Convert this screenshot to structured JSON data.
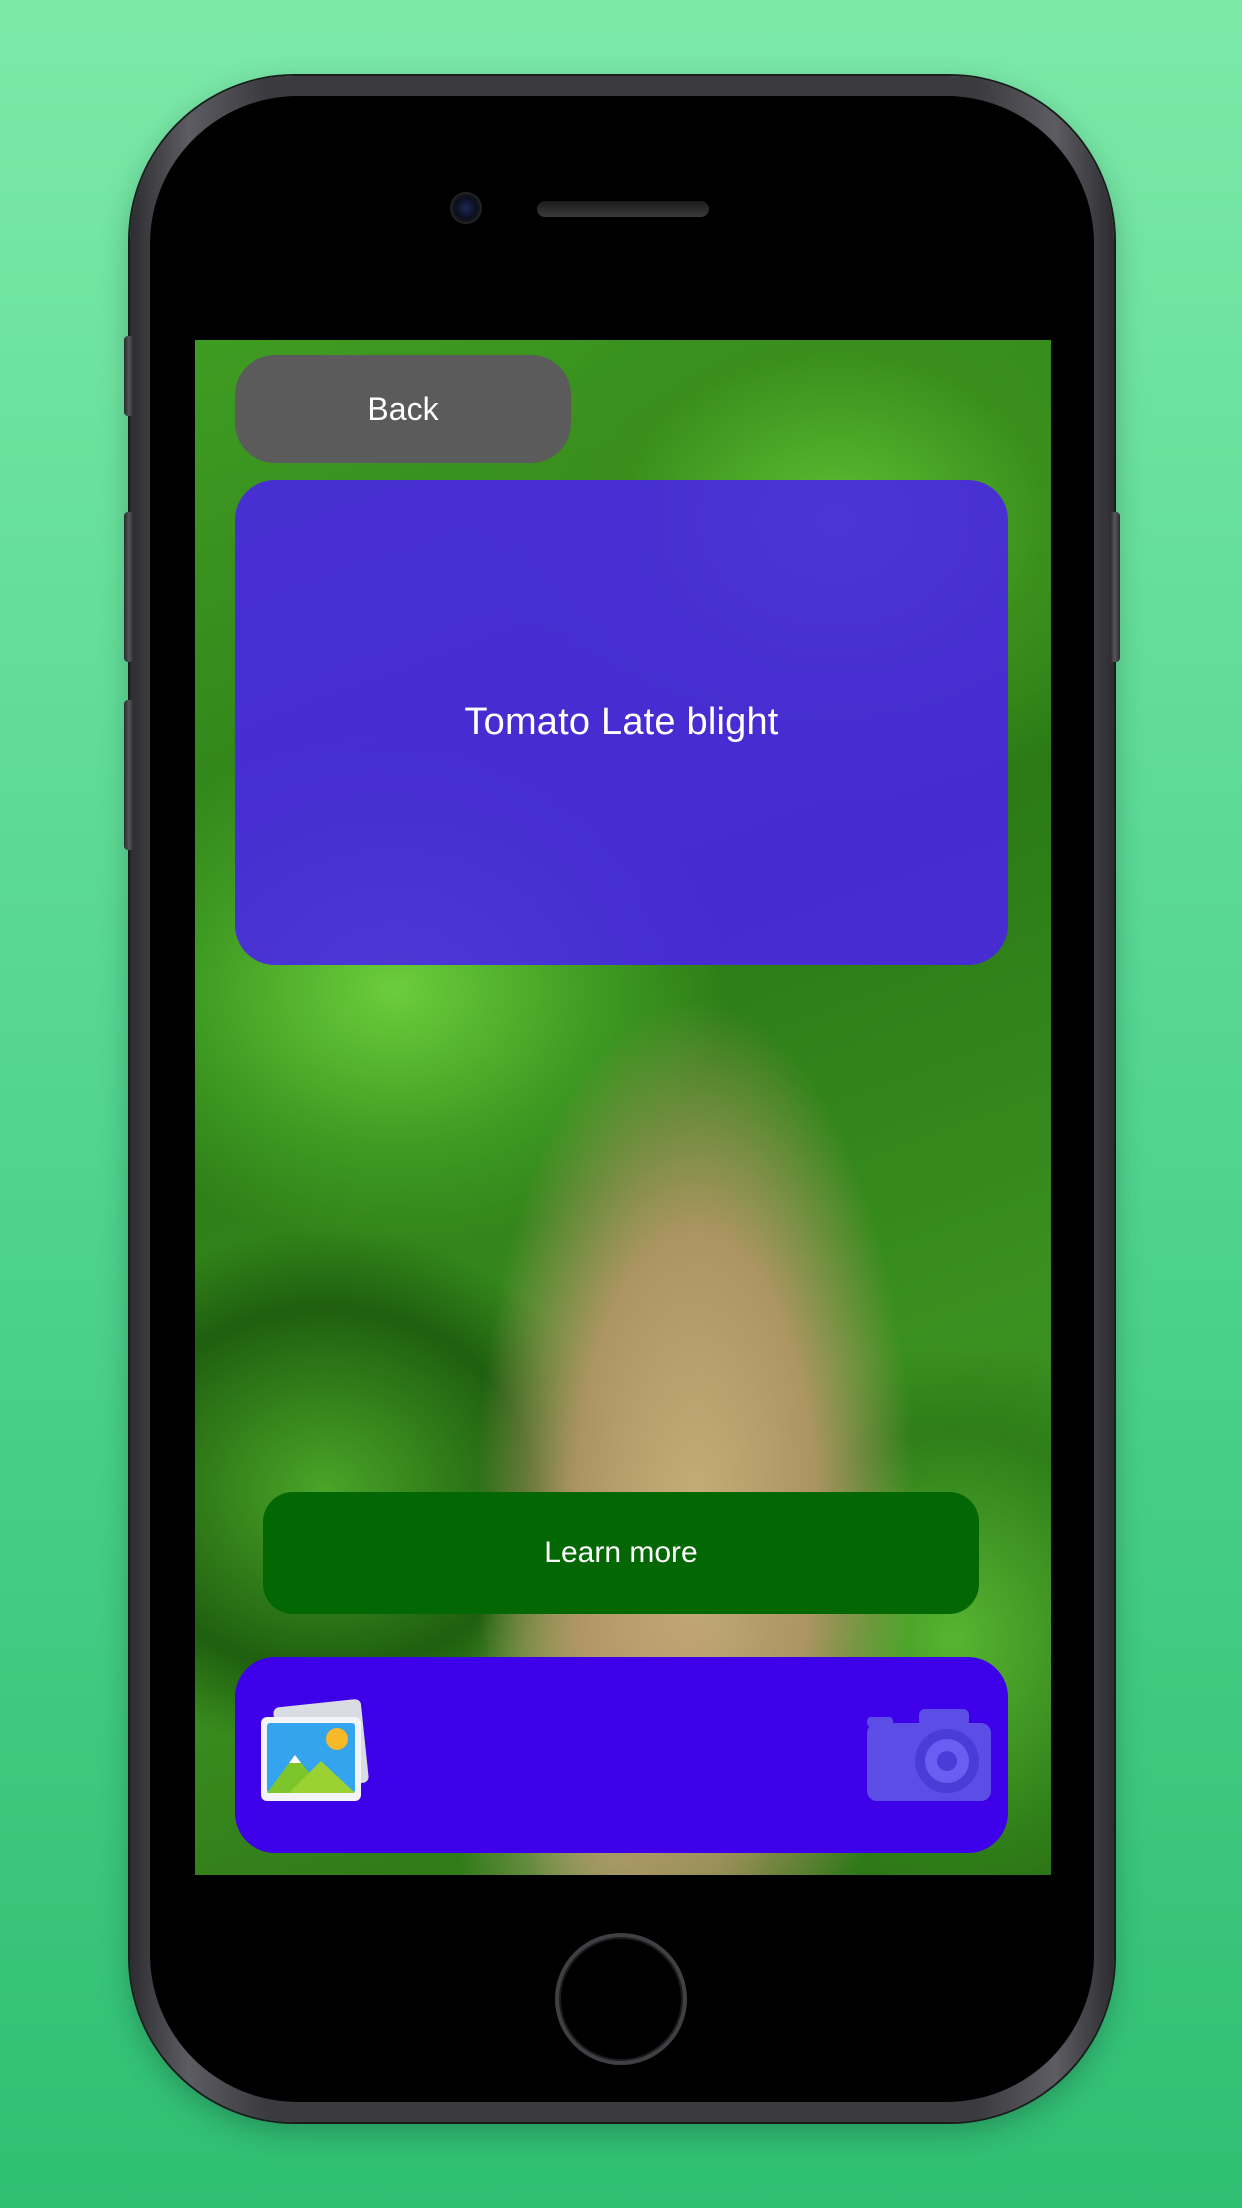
{
  "result": {
    "disease_name": "Tomato Late blight"
  },
  "buttons": {
    "back_label": "Back",
    "learn_more_label": "Learn more"
  },
  "bottom_bar": {
    "left_icon": "gallery-icon",
    "right_icon": "camera-icon"
  },
  "colors": {
    "background_green": "#52d58f",
    "back_button": "#5b5b5b",
    "result_card": "#4a1ef0",
    "learn_more_button": "#036703",
    "bottom_bar": "#3e00e8",
    "camera_icon": "#5b4de6"
  }
}
